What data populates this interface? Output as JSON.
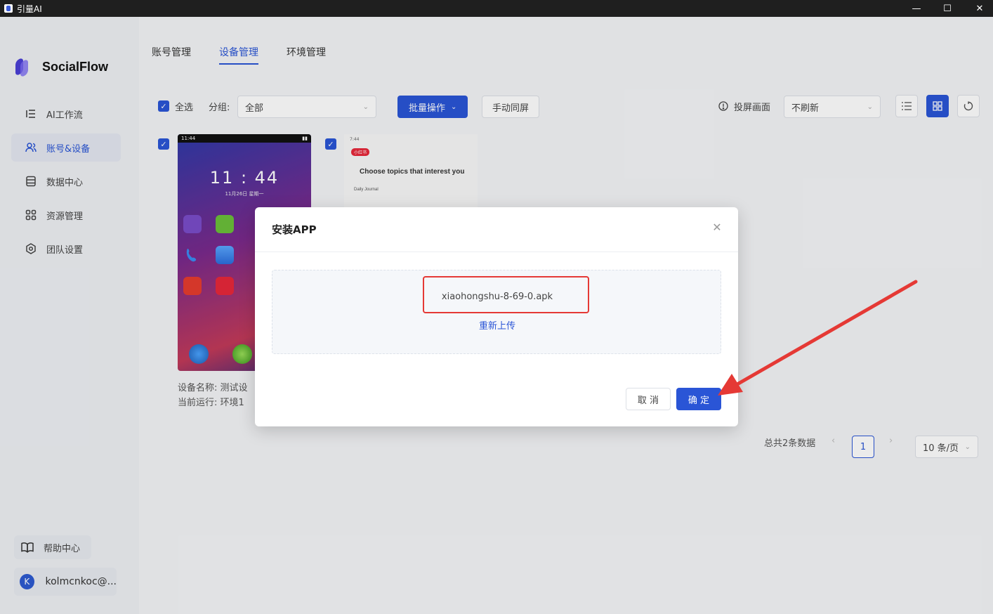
{
  "window": {
    "title": "引量AI",
    "minimize": "—",
    "maximize": "☐",
    "close": "✕"
  },
  "brand": {
    "name": "SocialFlow"
  },
  "sidebar": {
    "items": [
      {
        "label": "AI工作流",
        "icon": "list-icon"
      },
      {
        "label": "账号&设备",
        "icon": "users-icon",
        "active": true
      },
      {
        "label": "数据中心",
        "icon": "database-icon"
      },
      {
        "label": "资源管理",
        "icon": "grid-icon"
      },
      {
        "label": "团队设置",
        "icon": "gear-icon"
      }
    ],
    "help": "帮助中心",
    "user": {
      "avatar_letter": "K",
      "name": "kolmcnkoc@..."
    }
  },
  "tabs": [
    {
      "label": "账号管理"
    },
    {
      "label": "设备管理",
      "active": true
    },
    {
      "label": "环境管理"
    }
  ],
  "toolbar": {
    "select_all": "全选",
    "group_label": "分组:",
    "group_value": "全部",
    "batch_button": "批量操作",
    "mirror_button": "手动同屏",
    "cast_label": "投屏画面",
    "refresh_value": "不刷新"
  },
  "devices": [
    {
      "status_time": "11:44",
      "clock": "11 : 44",
      "date": "11月26日 星期一",
      "name_line": "设备名称: 测试设",
      "running_line": "当前运行: 环境1"
    },
    {
      "status_time": "7:44",
      "badge": "小红书",
      "topic_text": "Choose topics that interest you",
      "journal_text": "Daily Journal"
    }
  ],
  "pagination": {
    "total": "总共2条数据",
    "current": "1",
    "page_size": "10 条/页",
    "prev": "‹",
    "next": "›"
  },
  "modal": {
    "title": "安装APP",
    "file_name": "xiaohongshu-8-69-0.apk",
    "reupload": "重新上传",
    "cancel": "取 消",
    "confirm": "确 定"
  },
  "colors": {
    "primary": "#2a55d6",
    "annotation": "#e53935"
  }
}
